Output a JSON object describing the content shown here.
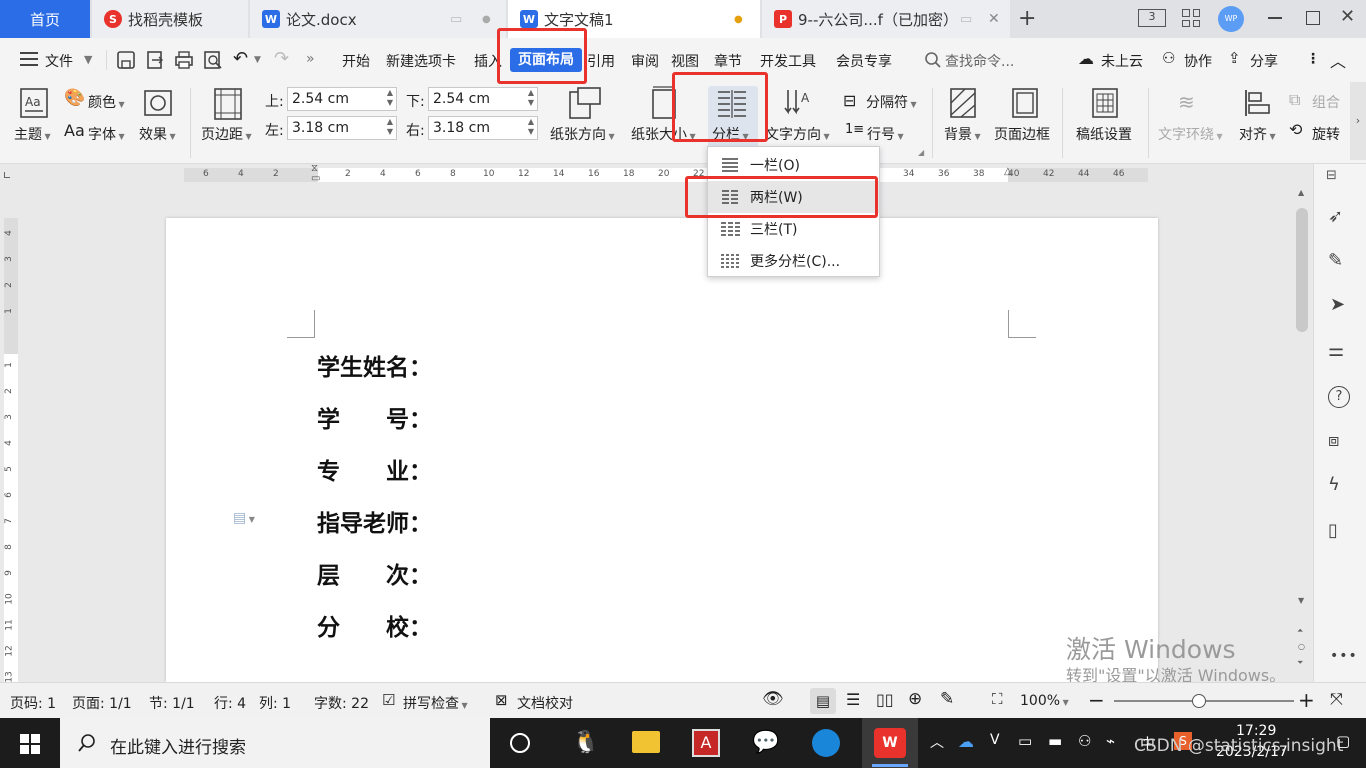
{
  "tabs": [
    {
      "label": "首页"
    },
    {
      "label": "找稻壳模板"
    },
    {
      "label": "论文.docx"
    },
    {
      "label": "文字文稿1"
    },
    {
      "label": "9--六公司...f（已加密）"
    }
  ],
  "menu": {
    "file": "文件",
    "items": [
      "开始",
      "新建选项卡",
      "插入",
      "页面布局",
      "引用",
      "审阅",
      "视图",
      "章节",
      "开发工具",
      "会员专享"
    ],
    "search_placeholder": "查找命令...",
    "cloud": "未上云",
    "collab": "协作",
    "share": "分享"
  },
  "ribbon": {
    "theme": "主题",
    "color": "颜色",
    "font": "字体",
    "font_glyph": "Aa",
    "effect": "效果",
    "margins": "页边距",
    "top_label": "上:",
    "top_value": "2.54 cm",
    "bottom_label": "下:",
    "bottom_value": "2.54 cm",
    "left_label": "左:",
    "left_value": "3.18 cm",
    "right_label": "右:",
    "right_value": "3.18 cm",
    "orientation": "纸张方向",
    "size": "纸张大小",
    "columns": "分栏",
    "text_direction": "文字方向",
    "breaks": "分隔符",
    "line_numbers": "行号",
    "background": "背景",
    "page_border": "页面边框",
    "manuscript": "稿纸设置",
    "wrap": "文字环绕",
    "align": "对齐",
    "group": "组合",
    "rotate": "旋转"
  },
  "ruler": {
    "h_left": [
      "6",
      "4",
      "2"
    ],
    "h_right": [
      "2",
      "4",
      "6",
      "8",
      "10",
      "12",
      "14",
      "16",
      "18",
      "20",
      "22"
    ],
    "h_far": [
      "34",
      "36",
      "38",
      "40",
      "42",
      "44",
      "46"
    ],
    "v_top": [
      "4",
      "3",
      "2",
      "1"
    ],
    "v_body": [
      "1",
      "2",
      "3",
      "4",
      "5",
      "6",
      "7",
      "8",
      "9",
      "10",
      "11",
      "12",
      "13"
    ]
  },
  "columns_menu": [
    {
      "label": "一栏(O)"
    },
    {
      "label": "两栏(W)"
    },
    {
      "label": "三栏(T)"
    },
    {
      "label": "更多分栏(C)..."
    }
  ],
  "document": {
    "lines": [
      "学生姓名：",
      "学　　号：",
      "专　　业：",
      "指导老师：",
      "层　　次：",
      "分　　校："
    ]
  },
  "status": {
    "page_code": "页码: 1",
    "pages": "页面: 1/1",
    "section": "节: 1/1",
    "row": "行: 4",
    "col": "列: 1",
    "words": "字数: 22",
    "spell": "拼写检查",
    "proof": "文档校对",
    "zoom": "100%"
  },
  "watermark": {
    "line1": "激活 Windows",
    "line2": "转到\"设置\"以激活 Windows。"
  },
  "taskbar": {
    "search_placeholder": "在此键入进行搜索",
    "ime": "中",
    "time": "17:29",
    "date": "2023/2/17",
    "credit": "CSDN @statistics.insight"
  },
  "colors": {
    "accent": "#2b6de6",
    "highlight": "#e8322b",
    "active_tab_bg": "#ffffff"
  }
}
